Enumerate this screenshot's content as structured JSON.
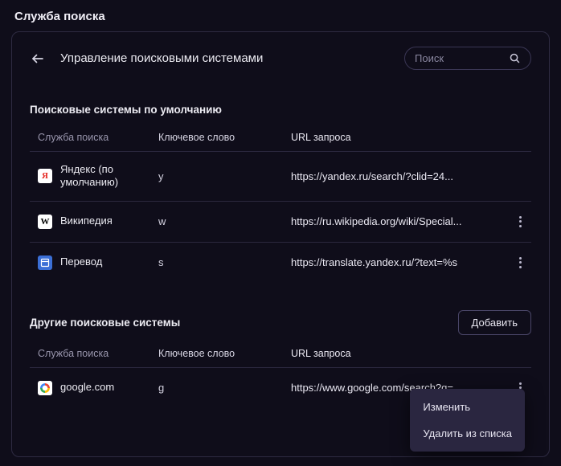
{
  "page_title": "Служба поиска",
  "header": {
    "title": "Управление поисковыми системами",
    "search_placeholder": "Поиск"
  },
  "default_section": {
    "title": "Поисковые системы по умолчанию",
    "columns": {
      "name": "Служба поиска",
      "keyword": "Ключевое слово",
      "url": "URL запроса"
    },
    "engines": [
      {
        "name": "Яндекс (по умолчанию)",
        "keyword": "y",
        "url": "https://yandex.ru/search/?clid=24...",
        "icon": "yandex",
        "has_menu": false
      },
      {
        "name": "Википедия",
        "keyword": "w",
        "url": "https://ru.wikipedia.org/wiki/Special...",
        "icon": "wiki",
        "has_menu": true
      },
      {
        "name": "Перевод",
        "keyword": "s",
        "url": "https://translate.yandex.ru/?text=%s",
        "icon": "translate",
        "has_menu": true
      }
    ]
  },
  "other_section": {
    "title": "Другие поисковые системы",
    "add_button": "Добавить",
    "columns": {
      "name": "Служба поиска",
      "keyword": "Ключевое слово",
      "url": "URL запроса"
    },
    "engines": [
      {
        "name": "google.com",
        "keyword": "g",
        "url": "https://www.google.com/search?q=...",
        "icon": "google",
        "has_menu": true
      }
    ]
  },
  "context_menu": {
    "edit": "Изменить",
    "delete": "Удалить из списка"
  }
}
